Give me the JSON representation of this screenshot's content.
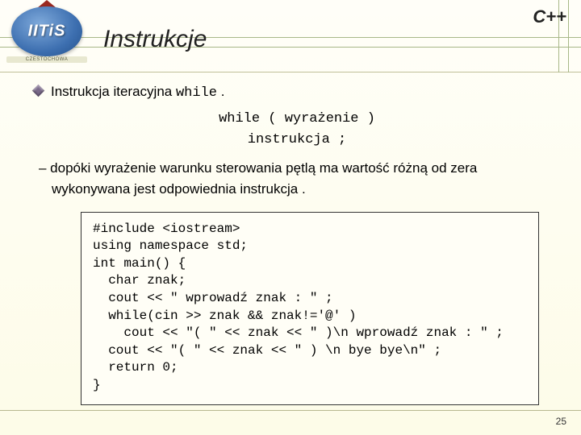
{
  "header": {
    "title": "Instrukcje",
    "lang": "C++",
    "logo_text": "IITiS",
    "logo_banner": "CZESTOCHOWA"
  },
  "bullet": {
    "text_prefix": "Instrukcja iteracyjna ",
    "keyword": "while",
    "suffix": " ."
  },
  "syntax": {
    "line1": "while ( wyrażenie )",
    "line2": "instrukcja ;"
  },
  "desc": {
    "line1": "– dopóki wyrażenie warunku sterowania pętlą ma wartość różną od zera",
    "line2": "wykonywana jest odpowiednia instrukcja ."
  },
  "code": "#include <iostream>\nusing namespace std;\nint main() {\n  char znak;\n  cout << \" wprowadź znak : \" ;\n  while(cin >> znak && znak!='@' )\n    cout << \"( \" << znak << \" )\\n wprowadź znak : \" ;\n  cout << \"( \" << znak << \" ) \\n bye bye\\n\" ;\n  return 0;\n}",
  "page_number": "25"
}
